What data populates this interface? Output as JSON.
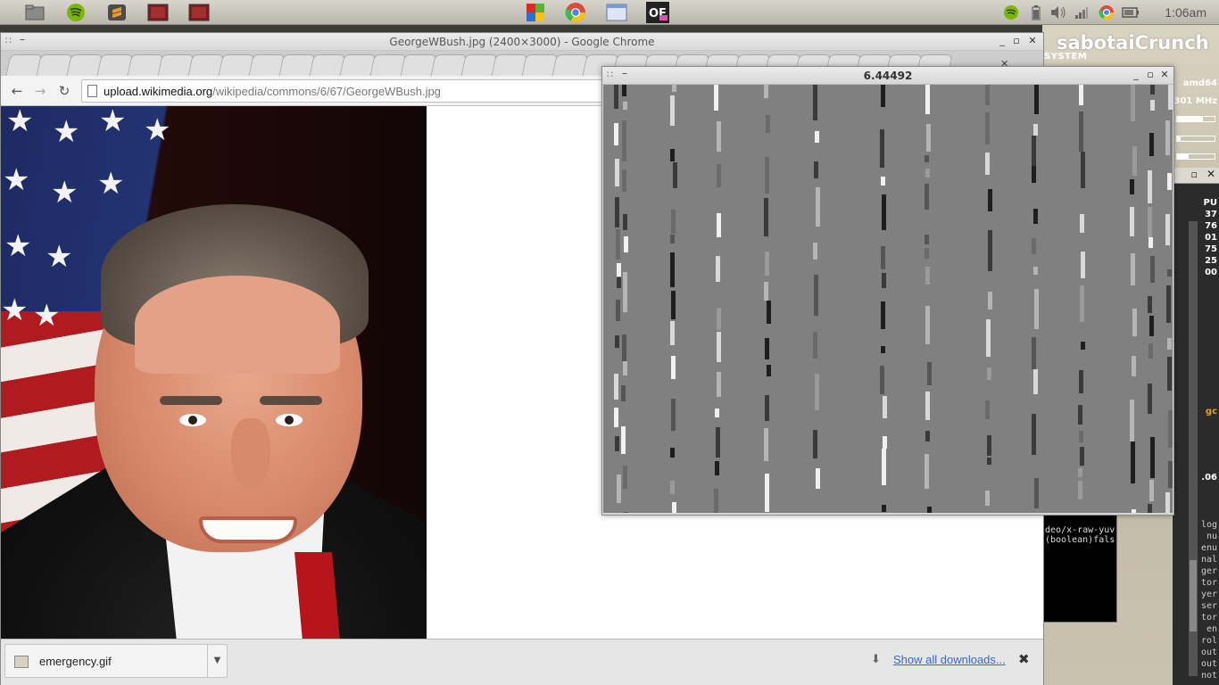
{
  "panel": {
    "clock": "1:06am",
    "launchers": [
      "files-icon",
      "spotify-icon",
      "sublime-icon",
      "terminal-icon",
      "terminal-icon-2"
    ],
    "center_apps": [
      "office-icon",
      "chrome-icon",
      "window-icon",
      "openframeworks-icon"
    ],
    "tray": [
      "spotify-tray-icon",
      "battery-icon",
      "volume-icon",
      "network-icon",
      "chrome-tray-icon",
      "display-icon"
    ]
  },
  "conky": {
    "title": "sabotaiCrunch",
    "system_label": "SYSTEM",
    "kernel": "amd64",
    "cpu_freq": "301 MHz",
    "values": [
      "PU",
      "37",
      "76",
      "01",
      "75",
      "25",
      "00"
    ],
    "small": [
      ".06"
    ],
    "orange_text": "gc"
  },
  "terminal": {
    "lines": [
      "deo/x-raw-yuv",
      "(boolean)fals"
    ],
    "right_words": [
      "log",
      "nu",
      "enu",
      "nal",
      "ger",
      "tor",
      "yer",
      "ser",
      "tor",
      "en",
      "rol",
      "out",
      "out",
      "not"
    ]
  },
  "chrome": {
    "window_title": "GeorgeWBush.jpg (2400×3000) - Google Chrome",
    "url_host": "upload.wikimedia.org",
    "url_path": "/wikipedia/commons/6/67/GeorgeWBush.jpg",
    "tab_count": 31,
    "download": {
      "filename": "emergency.gif",
      "show_all": "Show all downloads..."
    }
  },
  "video_window": {
    "title": "6.44492"
  },
  "colors": {
    "panel": "#c9c6bd",
    "link": "#3367d6",
    "video_bg": "#808080"
  }
}
